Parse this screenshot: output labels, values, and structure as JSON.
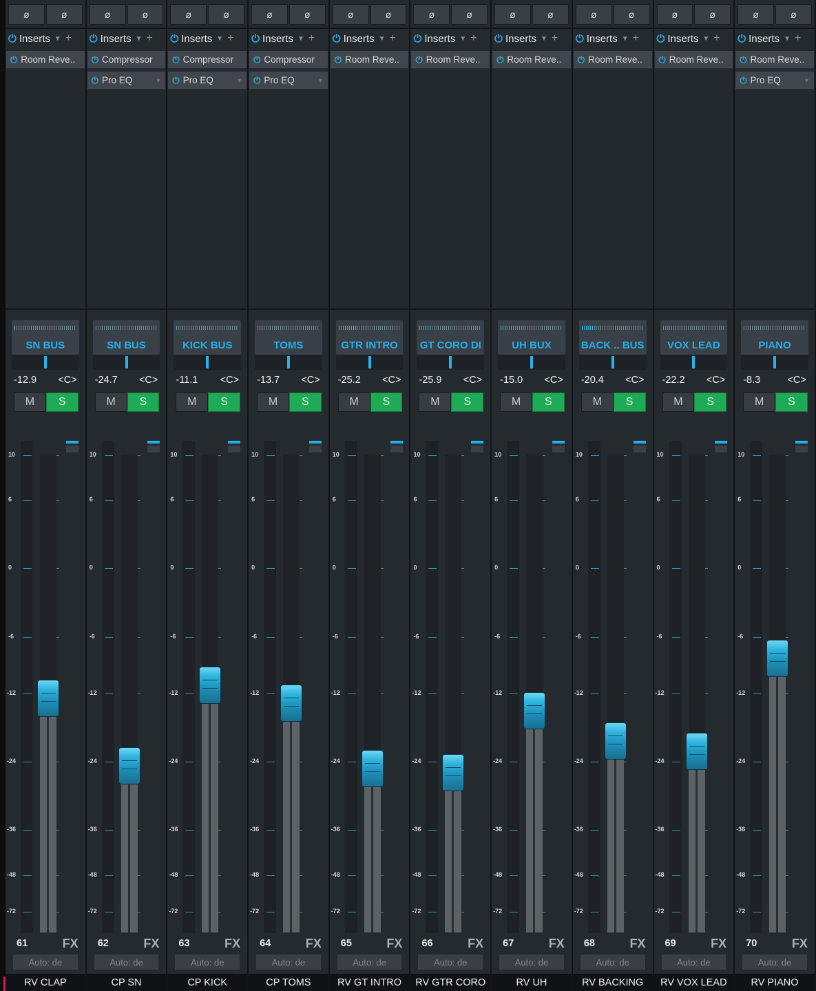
{
  "ui": {
    "phase_symbol": "ø",
    "inserts_label": "Inserts",
    "inserts_arrow": "▼",
    "inserts_add": "+",
    "power_glyph": "⏻",
    "mute_label": "M",
    "solo_label": "S",
    "pan_label": "<C>",
    "fx_label": "FX",
    "automation_label": "Auto: de",
    "fader_scale": [
      "10",
      "6",
      "0",
      "-6",
      "-12",
      "-24",
      "-36",
      "-48",
      "-72"
    ]
  },
  "colors": {
    "accent": "#25aee7",
    "solo_active": "#1faa55",
    "strip_bg": "#252a2f"
  },
  "channels": [
    {
      "number": "61",
      "name": "RV CLAP",
      "dest": "SN BUS",
      "volume": "-12.9",
      "inserts": [
        "Room Reve.."
      ],
      "fader_db": -12.9,
      "meter_level": 0.0
    },
    {
      "number": "62",
      "name": "CP SN",
      "dest": "SN BUS",
      "volume": "-24.7",
      "inserts": [
        "Compressor",
        "Pro EQ"
      ],
      "fader_db": -24.7,
      "meter_level": 0.0
    },
    {
      "number": "63",
      "name": "CP KICK",
      "dest": "KICK BUS",
      "volume": "-11.1",
      "inserts": [
        "Compressor",
        "Pro EQ"
      ],
      "fader_db": -11.1,
      "meter_level": 0.0
    },
    {
      "number": "64",
      "name": "CP TOMS",
      "dest": "TOMS",
      "volume": "-13.7",
      "inserts": [
        "Compressor",
        "Pro EQ"
      ],
      "fader_db": -13.7,
      "meter_level": 0.0
    },
    {
      "number": "65",
      "name": "RV GT INTRO",
      "dest": "GTR INTRO",
      "volume": "-25.2",
      "inserts": [
        "Room Reve.."
      ],
      "fader_db": -25.2,
      "meter_level": 0.3
    },
    {
      "number": "66",
      "name": "RV GTR CORO",
      "dest": "GT CORO DI",
      "volume": "-25.9",
      "inserts": [
        "Room Reve.."
      ],
      "fader_db": -25.9,
      "meter_level": 0.2
    },
    {
      "number": "67",
      "name": "RV UH",
      "dest": "UH BUX",
      "volume": "-15.0",
      "inserts": [
        "Room Reve.."
      ],
      "fader_db": -15.0,
      "meter_level": 0.15
    },
    {
      "number": "68",
      "name": "RV BACKING",
      "dest": "BACK .. BUS",
      "volume": "-20.4",
      "inserts": [
        "Room Reve.."
      ],
      "fader_db": -20.4,
      "meter_level": 0.2
    },
    {
      "number": "69",
      "name": "RV VOX LEAD",
      "dest": "VOX LEAD",
      "volume": "-22.2",
      "inserts": [
        "Room Reve.."
      ],
      "fader_db": -22.2,
      "meter_level": 0.0
    },
    {
      "number": "70",
      "name": "RV PIANO",
      "dest": "PIANO",
      "volume": "-8.3",
      "inserts": [
        "Room Reve..",
        "Pro EQ"
      ],
      "fader_db": -8.3,
      "meter_level": 0.0
    }
  ]
}
